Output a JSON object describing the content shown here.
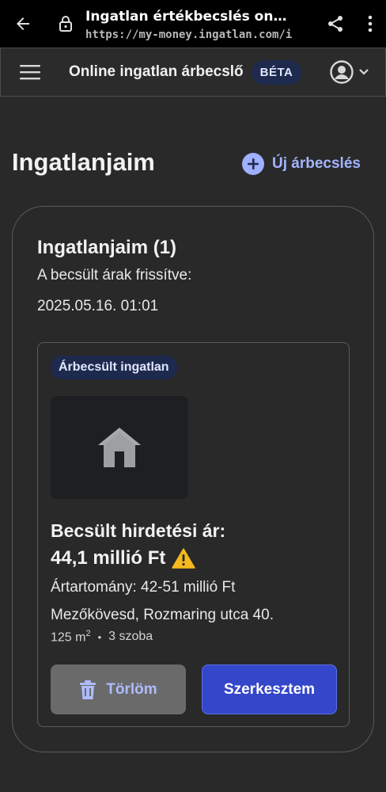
{
  "browser": {
    "page_title": "Ingatlan értékbecslés on…",
    "url": "https://my-money.ingatlan.com/i"
  },
  "header": {
    "title": "Online ingatlan árbecslő",
    "badge": "BÉTA"
  },
  "page": {
    "title": "Ingatlanjaim",
    "new_action": "Új árbecslés"
  },
  "card": {
    "heading": "Ingatlanjaim (1)",
    "refresh_label": "A becsült árak frissítve:",
    "refresh_date": "2025.05.16. 01:01"
  },
  "property": {
    "badge": "Árbecsült ingatlan",
    "price_label": "Becsült hirdetési ár:",
    "price_value": "44,1 millió Ft",
    "range": "Ártartomány: 42-51 millió Ft",
    "address": "Mezőkövesd, Rozmaring utca 40.",
    "area": "125 m",
    "area_sup": "2",
    "separator": "•",
    "rooms": "3 szoba",
    "delete_label": "Törlöm",
    "edit_label": "Szerkesztem"
  },
  "icons": {
    "back": "arrow-back-icon",
    "lock": "lock-icon",
    "share": "share-icon",
    "more": "more-vert-icon",
    "menu": "hamburger-icon",
    "profile": "user-circle-icon",
    "chevron": "chevron-down-icon",
    "plus": "plus-circle-icon",
    "house": "house-icon",
    "warning": "warning-icon",
    "trash": "trash-icon"
  },
  "colors": {
    "accent": "#9eb0ff",
    "primary_button": "#3446c9",
    "badge_bg": "#1e2a4d",
    "warning": "#f5b91f"
  }
}
